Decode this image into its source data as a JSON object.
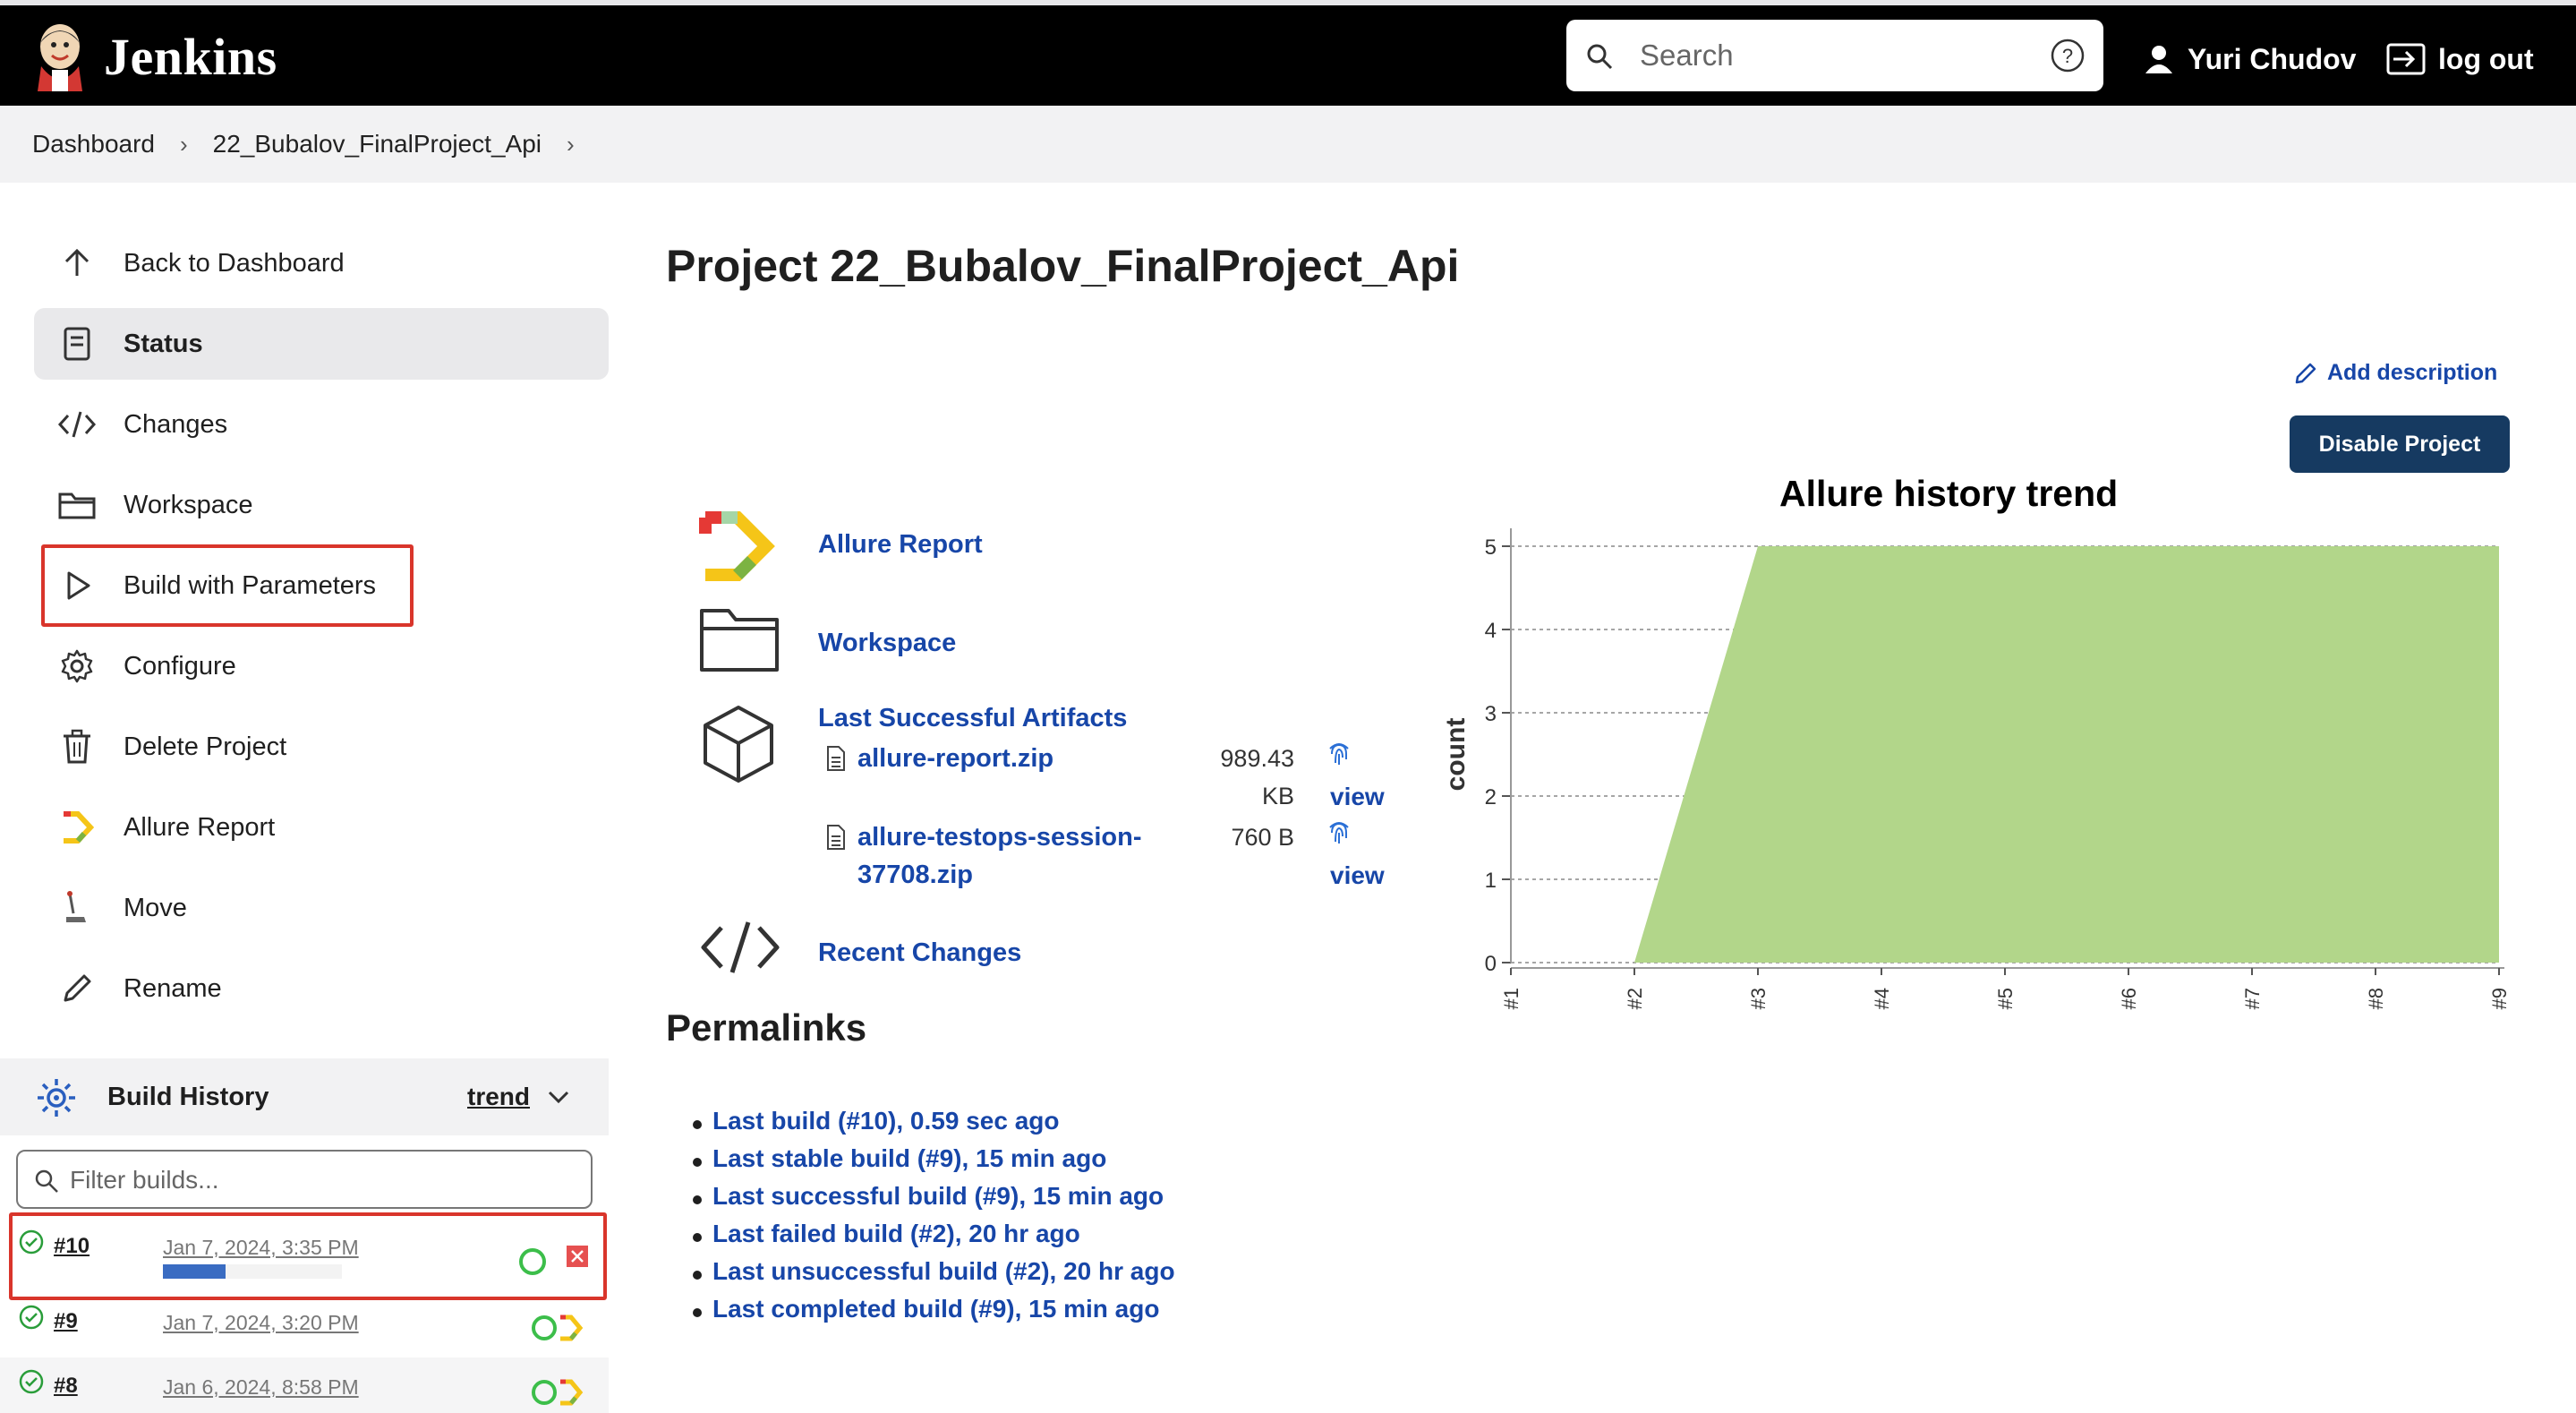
{
  "header": {
    "brand": "Jenkins",
    "search_placeholder": "Search",
    "user_name": "Yuri Chudov",
    "logout_label": "log out"
  },
  "breadcrumb": [
    "Dashboard",
    "22_Bubalov_FinalProject_Api"
  ],
  "sidebar": {
    "items": [
      {
        "label": "Back to Dashboard",
        "icon": "arrow-up-icon"
      },
      {
        "label": "Status",
        "icon": "document-icon"
      },
      {
        "label": "Changes",
        "icon": "code-icon"
      },
      {
        "label": "Workspace",
        "icon": "folder-icon"
      },
      {
        "label": "Build with Parameters",
        "icon": "play-icon"
      },
      {
        "label": "Configure",
        "icon": "gear-icon"
      },
      {
        "label": "Delete Project",
        "icon": "trash-icon"
      },
      {
        "label": "Allure Report",
        "icon": "allure-icon"
      },
      {
        "label": "Move",
        "icon": "move-icon"
      },
      {
        "label": "Rename",
        "icon": "pencil-icon"
      }
    ]
  },
  "build_history": {
    "title": "Build History",
    "trend_label": "trend",
    "filter_placeholder": "Filter builds...",
    "builds": [
      {
        "number": "#10",
        "date": "Jan 7, 2024, 3:35 PM",
        "in_progress": true,
        "progress": 0.35
      },
      {
        "number": "#9",
        "date": "Jan 7, 2024, 3:20 PM",
        "in_progress": false
      },
      {
        "number": "#8",
        "date": "Jan 6, 2024, 8:58 PM",
        "in_progress": false
      }
    ]
  },
  "main": {
    "title": "Project 22_Bubalov_FinalProject_Api",
    "add_description": "Add description",
    "disable_button": "Disable Project",
    "links": {
      "allure_report": "Allure Report",
      "workspace": "Workspace",
      "last_artifacts": "Last Successful Artifacts",
      "recent_changes": "Recent Changes"
    },
    "artifacts": [
      {
        "name_lines": [
          "allure-report.zip"
        ],
        "size_lines": [
          "989.43",
          "KB"
        ],
        "view": "view"
      },
      {
        "name_lines": [
          "allure-testops-session-",
          "37708.zip"
        ],
        "size_lines": [
          "760 B"
        ],
        "view": "view"
      }
    ],
    "permalinks_title": "Permalinks",
    "permalinks": [
      "Last build (#10), 0.59 sec ago",
      "Last stable build (#9), 15 min ago",
      "Last successful build (#9), 15 min ago",
      "Last failed build (#2), 20 hr ago",
      "Last unsuccessful build (#2), 20 hr ago",
      "Last completed build (#9), 15 min ago"
    ]
  },
  "chart_data": {
    "type": "area",
    "title": "Allure history trend",
    "ylabel": "count",
    "xlabel": "",
    "x": [
      "#1",
      "#2",
      "#3",
      "#4",
      "#5",
      "#6",
      "#7",
      "#8",
      "#9"
    ],
    "series": [
      {
        "values": [
          null,
          0,
          5,
          5,
          5,
          5,
          5,
          5,
          5
        ]
      }
    ],
    "ylim": [
      0,
      5
    ],
    "yticks": [
      0,
      1,
      2,
      3,
      4,
      5
    ],
    "grid": true,
    "color": "#b2d68a"
  },
  "colors": {
    "header_bg": "#000000",
    "link": "#1746a8",
    "primary_button": "#163a61",
    "highlight": "#d9352b",
    "success": "#2a9d3a"
  }
}
